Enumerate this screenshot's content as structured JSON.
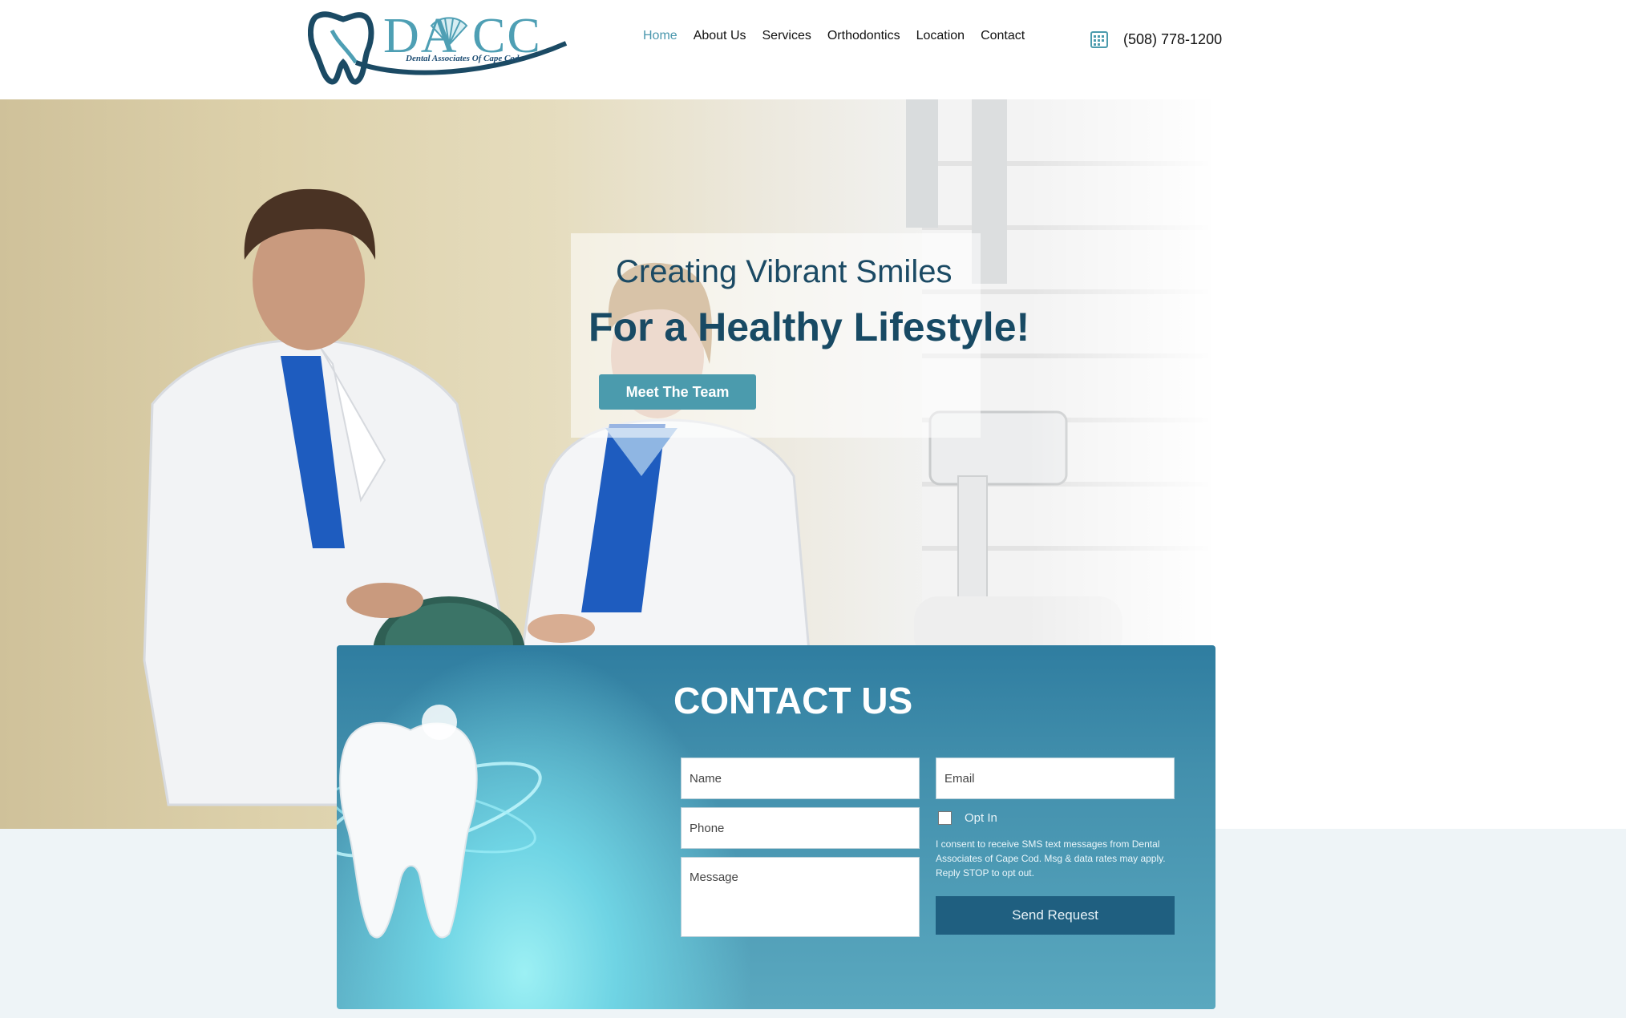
{
  "header": {
    "logo": {
      "lettering": "DA CC",
      "subtitle": "Dental Associates Of Cape Cod"
    },
    "nav": [
      {
        "label": "Home",
        "active": true
      },
      {
        "label": "About Us",
        "active": false
      },
      {
        "label": "Services",
        "active": false
      },
      {
        "label": "Orthodontics",
        "active": false
      },
      {
        "label": "Location",
        "active": false
      },
      {
        "label": "Contact",
        "active": false
      }
    ],
    "phone": "(508) 778-1200",
    "phone_icon": "calendar-icon"
  },
  "hero": {
    "line1": "Creating Vibrant Smiles",
    "line2": "For a Healthy Lifestyle!",
    "button": "Meet The Team"
  },
  "contact": {
    "title": "CONTACT US",
    "name_placeholder": "Name",
    "phone_placeholder": "Phone",
    "message_placeholder": "Message",
    "email_placeholder": "Email",
    "optin_label": "Opt In",
    "consent": "I consent to receive SMS text messages from Dental Associates of Cape Cod. Msg & data rates may apply. Reply STOP to opt out.",
    "send_button": "Send Request"
  },
  "colors": {
    "accent": "#4b9bad",
    "brand_dark": "#184a64",
    "send_button": "#1f5f80"
  }
}
